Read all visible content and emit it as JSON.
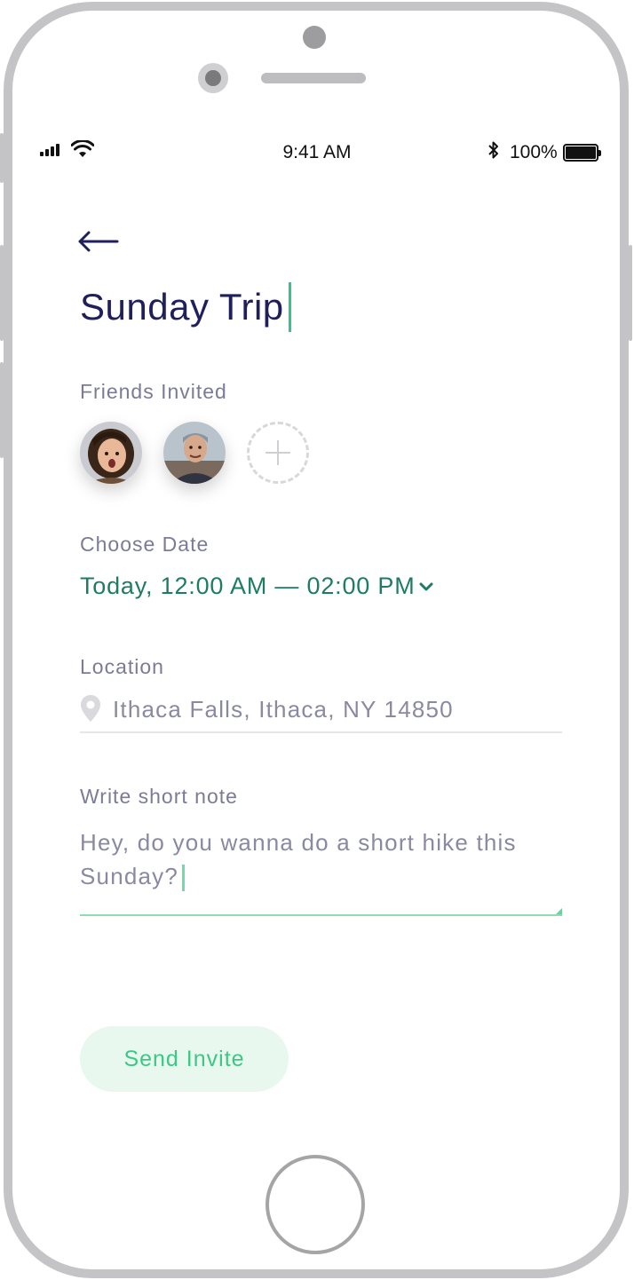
{
  "status_bar": {
    "time": "9:41 AM",
    "battery": "100%",
    "icons": [
      "signal-icon",
      "wifi-icon",
      "bluetooth-icon",
      "battery-icon"
    ]
  },
  "header": {
    "back_icon": "arrow-left-icon",
    "title": "Sunday Trip"
  },
  "friends": {
    "label": "Friends Invited",
    "avatars": [
      "avatar-woman",
      "avatar-man"
    ],
    "add_icon": "plus-icon"
  },
  "date": {
    "label": "Choose Date",
    "value": "Today, 12:00 AM — 02:00 PM",
    "icon": "chevron-down-icon"
  },
  "location": {
    "label": "Location",
    "value": "Ithaca Falls, Ithaca, NY 14850",
    "icon": "map-pin-icon"
  },
  "note": {
    "label": "Write short note",
    "value": "Hey, do you wanna do a short hike this Sunday?"
  },
  "send_button": {
    "label": "Send Invite"
  },
  "colors": {
    "title": "#1e1f5c",
    "accent_green": "#3ec784",
    "date_green": "#1f7c64",
    "label_gray": "#7c7b97",
    "button_bg": "#e8f8ef"
  }
}
